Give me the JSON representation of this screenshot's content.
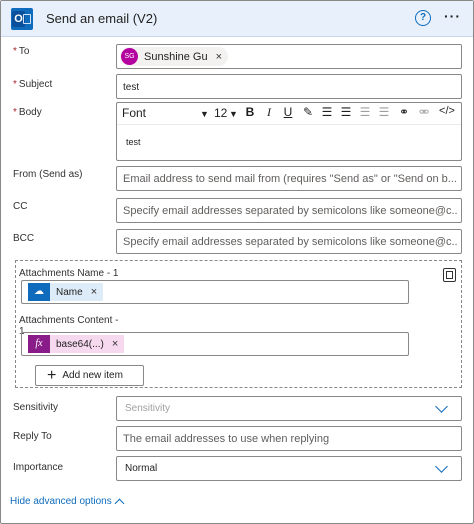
{
  "header": {
    "title": "Send an email (V2)",
    "help_icon": "?",
    "more_icon": "···"
  },
  "fields": {
    "to": {
      "label": "To",
      "required": "*",
      "token": {
        "initials": "SG",
        "name": "Sunshine Gu",
        "remove": "×"
      }
    },
    "subject": {
      "label": "Subject",
      "required": "*",
      "value": "test"
    },
    "body": {
      "label": "Body",
      "required": "*",
      "font": "Font",
      "size": "12",
      "value": "test",
      "toolbar": {
        "bold": "B",
        "italic": "I",
        "underline": "U"
      }
    },
    "from": {
      "label": "From (Send as)",
      "placeholder": "Email address to send mail from (requires \"Send as\" or \"Send on b..."
    },
    "cc": {
      "label": "CC",
      "placeholder": "Specify email addresses separated by semicolons like someone@c..."
    },
    "bcc": {
      "label": "BCC",
      "placeholder": "Specify email addresses separated by semicolons like someone@c..."
    }
  },
  "attachments": {
    "name_label": "Attachments Name - 1",
    "name_token": {
      "text": "Name",
      "remove": "×",
      "color": "#0f6cbd"
    },
    "content_label_line1": "Attachments Content -",
    "content_label_line2": "1",
    "content_token": {
      "icon": "fx",
      "text": "base64(...)",
      "remove": "×",
      "color": "#8a1c8a",
      "bg": "#f6d9ef"
    },
    "add_button": "Add new item"
  },
  "sensitivity": {
    "label": "Sensitivity",
    "placeholder": "Sensitivity"
  },
  "reply_to": {
    "label": "Reply To",
    "placeholder": "The email addresses to use when replying"
  },
  "importance": {
    "label": "Importance",
    "value": "Normal"
  },
  "advanced": {
    "label": "Hide advanced options"
  },
  "colors": {
    "accent": "#0f6cbd",
    "avatar": "#b4009e",
    "required": "#a4262c"
  }
}
